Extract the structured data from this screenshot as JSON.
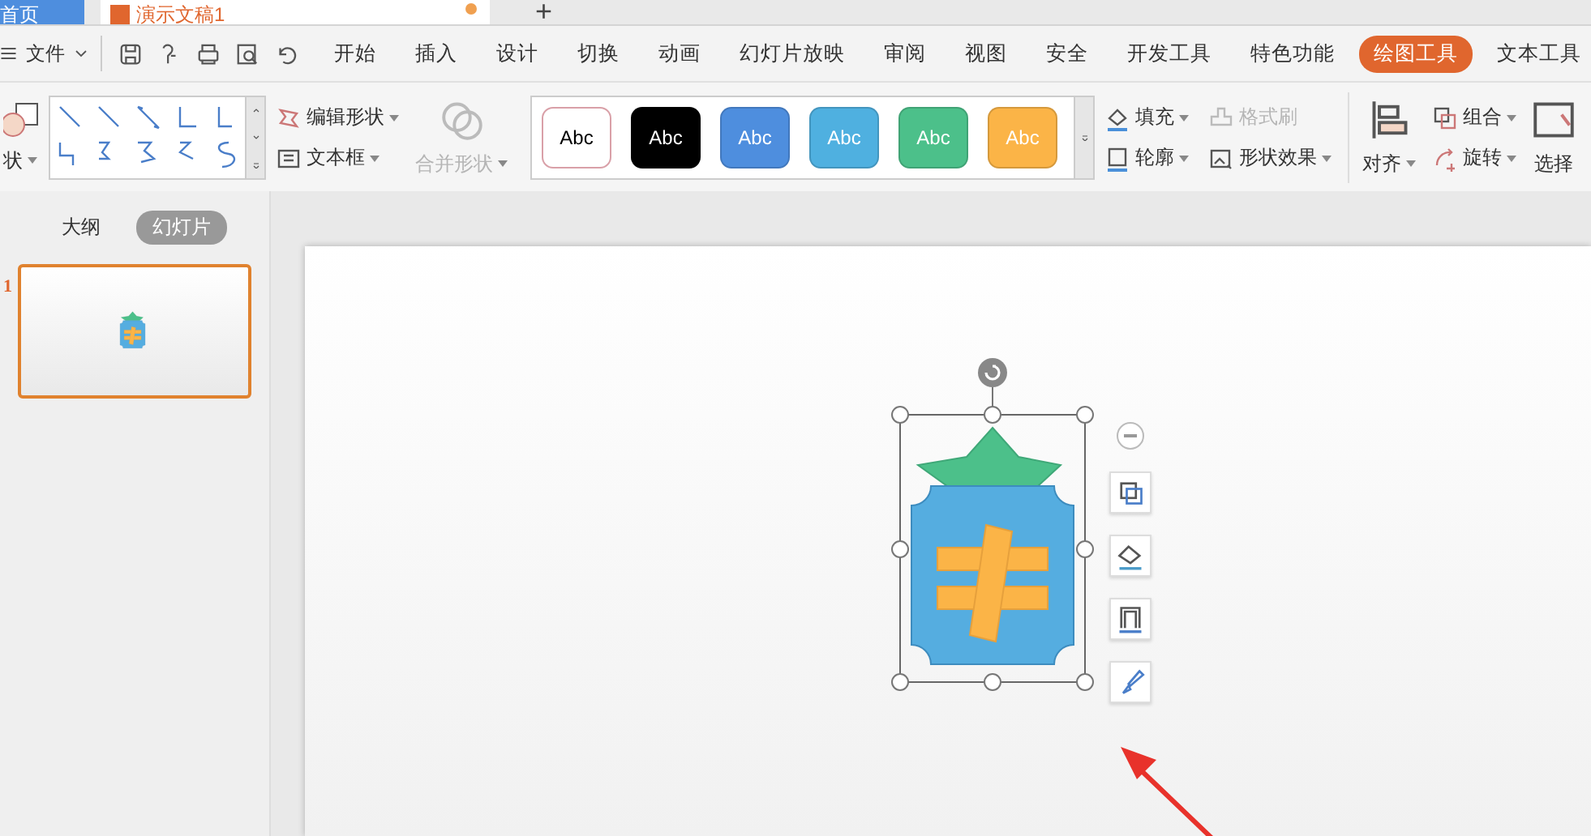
{
  "document_tabs": [
    {
      "label": "首页",
      "kind": "home"
    },
    {
      "label": "演示文稿1",
      "kind": "document",
      "unsaved": true
    }
  ],
  "new_tab": "+",
  "menu": {
    "file": "文件",
    "items": [
      {
        "label": "开始",
        "selected": false
      },
      {
        "label": "插入",
        "selected": false
      },
      {
        "label": "设计",
        "selected": false
      },
      {
        "label": "切换",
        "selected": false
      },
      {
        "label": "动画",
        "selected": false
      },
      {
        "label": "幻灯片放映",
        "selected": false
      },
      {
        "label": "审阅",
        "selected": false
      },
      {
        "label": "视图",
        "selected": false
      },
      {
        "label": "安全",
        "selected": false
      },
      {
        "label": "开发工具",
        "selected": false
      },
      {
        "label": "特色功能",
        "selected": false
      },
      {
        "label": "绘图工具",
        "selected": true
      },
      {
        "label": "文本工具",
        "selected": false
      }
    ]
  },
  "ribbon": {
    "shape": "状",
    "edit_shape": "编辑形状",
    "textbox": "文本框",
    "merge_shapes": {
      "label": "合并形状",
      "disabled": true
    },
    "styles": [
      {
        "label": "Abc",
        "color": "#ffffff"
      },
      {
        "label": "Abc",
        "color": "#000000"
      },
      {
        "label": "Abc",
        "color": "#4e8ede"
      },
      {
        "label": "Abc",
        "color": "#4fb0e0"
      },
      {
        "label": "Abc",
        "color": "#4cc08a"
      },
      {
        "label": "Abc",
        "color": "#fbb447"
      }
    ],
    "fill": "填充",
    "format_painter": {
      "label": "格式刷",
      "disabled": true
    },
    "outline": "轮廓",
    "shape_effects": "形状效果",
    "align": "对齐",
    "group": "组合",
    "rotate": "旋转",
    "selection": "选择"
  },
  "panel": {
    "tabs": [
      {
        "label": "大纲",
        "selected": false
      },
      {
        "label": "幻灯片",
        "selected": true
      }
    ],
    "slides": [
      {
        "number": "1",
        "selected": true
      }
    ]
  }
}
